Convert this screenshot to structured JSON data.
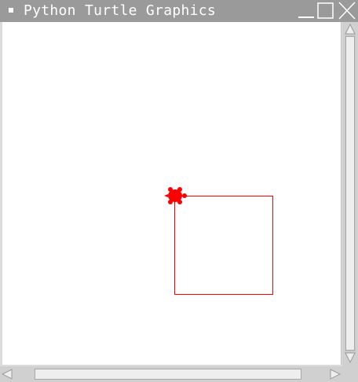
{
  "window": {
    "title": "Python Turtle Graphics"
  },
  "canvas": {
    "background": "#ffffff",
    "pen_color": "#ff0000",
    "turtle_color": "#ff0000",
    "shape": "square"
  },
  "icons": {
    "menu": "window-menu-icon",
    "minimize": "minimize-icon",
    "maximize": "maximize-icon",
    "close": "close-icon",
    "scroll_up": "arrow-up-icon",
    "scroll_down": "arrow-down-icon",
    "scroll_left": "arrow-left-icon",
    "scroll_right": "arrow-right-icon",
    "turtle": "turtle-icon"
  }
}
